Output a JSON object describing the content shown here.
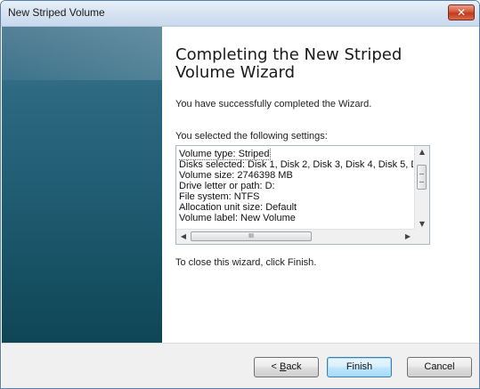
{
  "window": {
    "title": "New Striped Volume",
    "close_glyph": "✕"
  },
  "wizard": {
    "heading": "Completing the New Striped Volume Wizard",
    "success_text": "You have successfully completed the Wizard.",
    "selected_label": "You selected the following settings:",
    "settings": [
      "Volume type: Striped",
      "Disks selected: Disk 1, Disk 2, Disk 3, Disk 4, Disk 5, D",
      "Volume size: 2746398 MB",
      "Drive letter or path: D:",
      "File system: NTFS",
      "Allocation unit size: Default",
      "Volume label: New Volume"
    ],
    "close_note": "To close this wizard, click Finish."
  },
  "scrollbar": {
    "up": "▲",
    "down": "▼",
    "left": "◀",
    "right": "▶",
    "grip": "III"
  },
  "buttons": {
    "back_accel": "B",
    "back_rest": "ack",
    "back_prefix": "< ",
    "finish": "Finish",
    "cancel": "Cancel"
  },
  "colors": {
    "sidebar": "#1f5b71",
    "accent": "#3c7fb1",
    "close": "#c23a1c"
  }
}
